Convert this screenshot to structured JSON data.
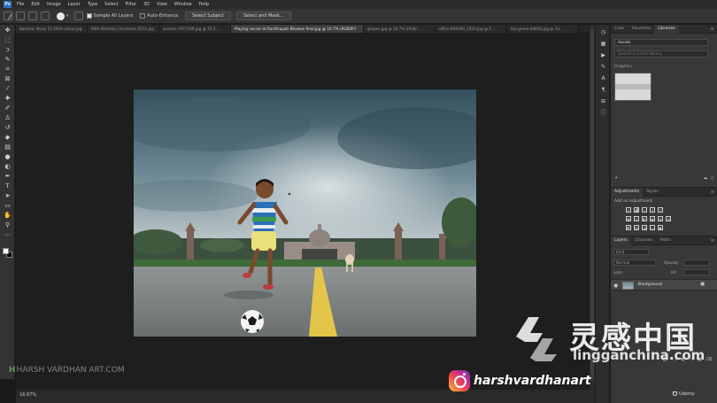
{
  "menu": {
    "app_logo": "Ps",
    "items": [
      "File",
      "Edit",
      "Image",
      "Layer",
      "Type",
      "Select",
      "Filter",
      "3D",
      "View",
      "Window",
      "Help"
    ]
  },
  "options": {
    "sample_all_layers": "Sample All Layers",
    "auto_enhance": "Auto-Enhance",
    "select_subject": "Select Subject",
    "select_and_mask": "Select and Mask..."
  },
  "tabs": [
    {
      "label": "Banaras 4Italy 15 2016 colour.jpg",
      "active": false
    },
    {
      "label": "60th Birthday Christmas 0211.jpg",
      "active": false
    },
    {
      "label": "woman-1071196.jpg @ 12.5...",
      "active": false
    },
    {
      "label": "Playing soccer at Rashtrapati Bhawan final.jpg @ 16.7% (RGB/8*)",
      "active": true
    },
    {
      "label": "grapes.jpg @ 16.7% (RGB/...",
      "active": false
    },
    {
      "label": "office-820390_1920.jpg @ 1...",
      "active": false
    },
    {
      "label": "tee-grove-44456.jpg @ 33...",
      "active": false
    }
  ],
  "status": {
    "zoom": "16.67%"
  },
  "libraries": {
    "tabs": [
      "Color",
      "Swatches",
      "Libraries"
    ],
    "active_tab": 2,
    "library_name": "Assets",
    "search_placeholder": "Search Current library",
    "graphics_header": "Graphics"
  },
  "adjustments": {
    "tabs": [
      "Adjustments",
      "Styles"
    ],
    "hint": "Add an adjustment"
  },
  "layers": {
    "tabs": [
      "Layers",
      "Channels",
      "Paths"
    ],
    "filter_kind": "Kind",
    "blend_mode": "Normal",
    "opacity_label": "Opacity:",
    "lock_label": "Lock:",
    "fill_label": "Fill:",
    "layer_name": "Background"
  },
  "overlays": {
    "watermark_left": "HARSH VARDHAN ART.COM",
    "instagram_handle": "harshvardhanart",
    "brand_cn": "灵感中国",
    "brand_url": "lingganchina.com",
    "udemy": "Udemy"
  }
}
